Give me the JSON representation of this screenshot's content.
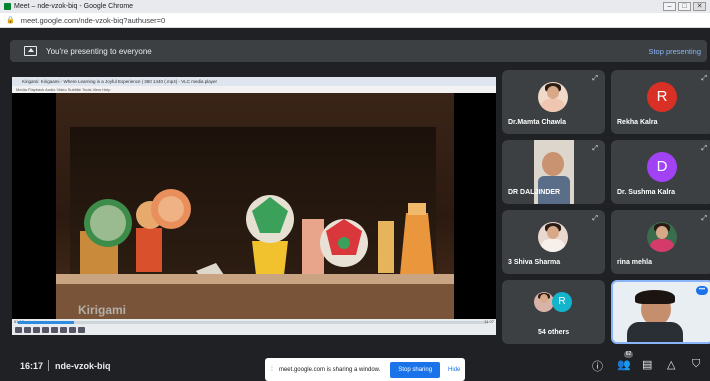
{
  "browser": {
    "window_title": "Meet – nde-vzok-biq - Google Chrome",
    "url": "meet.google.com/nde-vzok-biq?authuser=0"
  },
  "banner": {
    "text": "You're presenting to everyone",
    "stop_label": "Stop presenting"
  },
  "shared_window": {
    "vlc_title": "Kirigami: Kirigaami - Where Learning is a Joyful Experience | 360 1440 (.mp4) - VLC media player",
    "vlc_menu": "Media   Playback   Audio   Video   Subtitle   Tools   View   Help",
    "overlay_text": "Kirigami",
    "time_elapsed": "01:18",
    "time_total": "11:07",
    "progress": 0.12
  },
  "participants": [
    {
      "name": "Dr.Mamta Chawla",
      "type": "photo"
    },
    {
      "name": "Rekha Kalra",
      "type": "letter",
      "letter": "R",
      "color": "#d93025"
    },
    {
      "name": "DR DALJINDER",
      "type": "video"
    },
    {
      "name": "Dr. Sushma Kalra",
      "type": "letter",
      "letter": "D",
      "color": "#a142f4"
    },
    {
      "name": "3 Shiva Sharma",
      "type": "photo"
    },
    {
      "name": "rina mehla",
      "type": "photo"
    },
    {
      "name": "54 others",
      "type": "others",
      "letter": "R",
      "color": "#12b5cb"
    },
    {
      "name": "",
      "type": "self"
    }
  ],
  "bottom": {
    "time": "16:17",
    "meeting_code": "nde-vzok-biq",
    "people_count": "62"
  },
  "share_notice": {
    "text": "meet.google.com is sharing a window.",
    "stop_label": "Stop sharing",
    "hide_label": "Hide"
  },
  "icons": {
    "info": "info-icon",
    "people": "people-icon",
    "chat": "chat-icon",
    "activities": "activities-icon",
    "host_controls": "shield-icon"
  }
}
